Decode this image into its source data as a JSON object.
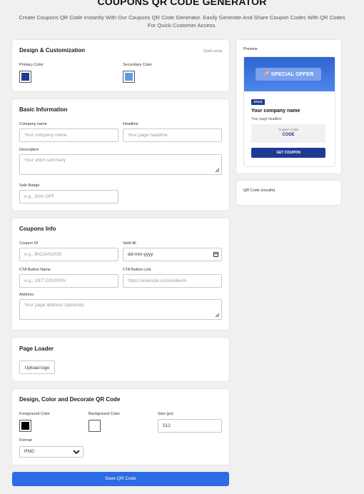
{
  "header": {
    "title": "COUPONS QR CODE GENERATOR",
    "subtitle": "Create Coupons QR Code Instantly With Our Coupons QR Code Generator. Easily Generate And Share Coupon Codes With QR Codes For Quick Customer Access."
  },
  "design": {
    "title": "Design & Customization",
    "quick_setup": "Quick setup",
    "primary_label": "Primary Color",
    "secondary_label": "Secondary Color",
    "primary_color": "#1f3a93",
    "secondary_color": "#5b9be8"
  },
  "basic": {
    "title": "Basic Information",
    "company_label": "Company name",
    "company_placeholder": "Your company name",
    "headline_label": "Headline",
    "headline_placeholder": "Your page headline",
    "description_label": "Description",
    "description_placeholder": "Your short summary",
    "sale_label": "Sale Badge",
    "sale_placeholder": "e.g., 50% OFF"
  },
  "coupons": {
    "title": "Coupons Info",
    "id_label": "Coupon ID",
    "id_placeholder": "e.g., BIGJAN2025",
    "valid_label": "Valid till",
    "valid_value": "dd-mm-yyyy",
    "cta_name_label": "CTA Button Name",
    "cta_name_placeholder": "e.g., GET COUPON",
    "cta_link_label": "CTA Button Link",
    "cta_link_placeholder": "https://example.com/redeem",
    "address_label": "Address",
    "address_placeholder": "Your page address (optional)"
  },
  "loader": {
    "title": "Page Loader",
    "upload_label": "Upload logo"
  },
  "qr": {
    "title": "Design, Color and Decorate QR Code",
    "fg_label": "Foreground Color",
    "bg_label": "Background Color",
    "size_label": "Size (px)",
    "size_value": "512",
    "fg_color": "#000000",
    "bg_color": "#ffffff",
    "format_label": "Format",
    "format_value": "PNG"
  },
  "save_label": "Save QR Code",
  "preview": {
    "title": "Preview",
    "offer_text": "SPECIAL OFFER",
    "offer_icon": "tag-icon",
    "sale_badge": "SALE",
    "company": "Your company name",
    "headline": "Your page headline",
    "code_label": "Coupon Code",
    "code_value": "CODE",
    "button": "GET COUPON"
  },
  "results": {
    "title": "QR Code (results)"
  }
}
